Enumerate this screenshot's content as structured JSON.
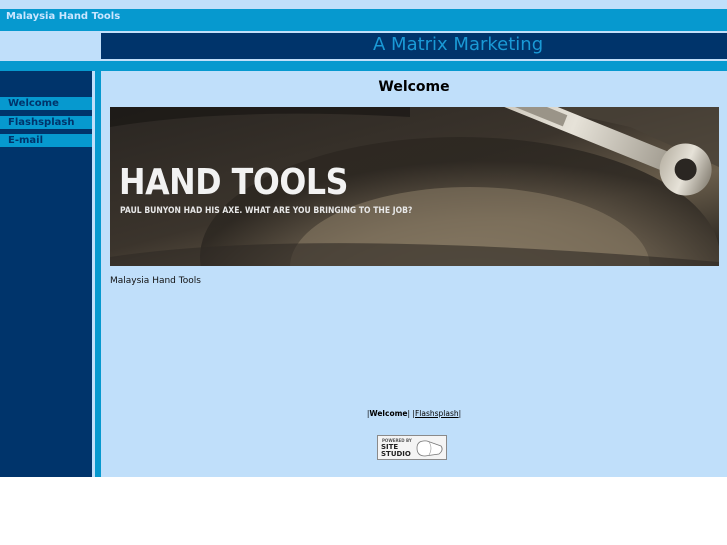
{
  "site": {
    "title": "Malaysia Hand Tools",
    "company": "A Matrix Marketing"
  },
  "nav": {
    "items": [
      {
        "label": "Welcome"
      },
      {
        "label": "Flashsplash"
      },
      {
        "label": "E-mail"
      }
    ]
  },
  "main": {
    "title": "Welcome",
    "banner": {
      "headline": "HAND TOOLS",
      "tagline": "PAUL BUNYON HAD HIS AXE. WHAT ARE YOU BRINGING TO THE JOB?"
    },
    "body_text": "Malaysia Hand Tools"
  },
  "footer": {
    "links": [
      {
        "label": "Welcome",
        "current": true
      },
      {
        "label": "Flashsplash",
        "current": false
      }
    ],
    "badge": {
      "line1": "POWERED BY",
      "line2": "SITE",
      "line3": "STUDIO"
    }
  },
  "colors": {
    "dark_navy": "#00346b",
    "cyan": "#0699cf",
    "light_blue": "#c0dffa"
  }
}
